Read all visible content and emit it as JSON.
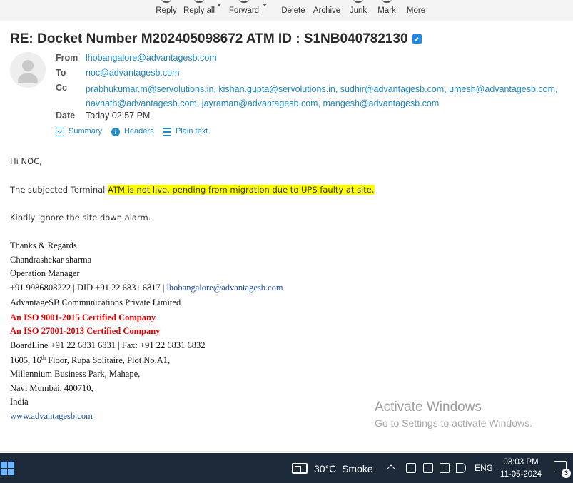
{
  "toolbar": {
    "reply": "Reply",
    "reply_all": "Reply all",
    "forward": "Forward",
    "delete": "Delete",
    "archive": "Archive",
    "junk": "Junk",
    "mark": "Mark",
    "more": "More"
  },
  "email": {
    "subject": "RE: Docket Number M202405098672 ATM ID : S1NB040782130",
    "from_label": "From",
    "from": "lhobangalore@advantagesb.com",
    "to_label": "To",
    "to": "noc@advantagesb.com",
    "cc_label": "Cc",
    "cc_line1": "prabhukumar.m@servolutions.in, kishan.gupta@servolutions.in, sudhir@advantagesb.com, umesh@advantagesb.com,",
    "cc_line2": "navnath@advantagesb.com, jayraman@advantagesb.com, mangesh@advantagesb.com",
    "date_label": "Date",
    "date": "Today 02:57 PM",
    "view_summary": "Summary",
    "view_headers": "Headers",
    "view_plain": "Plain text"
  },
  "body": {
    "greeting": "Hi NOC,",
    "line1_prefix": "The subjected Terminal ",
    "line1_highlight": "ATM is not live, pending from migration due to UPS faulty at site.",
    "line2": "Kindly ignore the site down alarm."
  },
  "signature": {
    "regards": "Thanks & Regards",
    "name": "Chandrashekar sharma",
    "title": "Operation Manager",
    "phone": "+91 9986808222 | DID +91 22 6831 6817 |  ",
    "phone_email": "lhobangalore@advantagesb.com",
    "company": "AdvantageSB Communications Private Limited",
    "iso1": "An ISO 9001-2015 Certified Company",
    "iso2": "An ISO 27001-2013 Certified Company",
    "boardline": "BoardLine +91 22 6831 6831 | Fax: +91 22 6831 6832",
    "addr1_pre": "1605, 16",
    "addr1_sup": "th",
    "addr1_post": " Floor, Rupa Solitaire, Plot No.A1,",
    "addr2": "Millennium Business Park, Mahape,",
    "addr3": "Navi Mumbai, 400710,",
    "addr4": "India",
    "website": "www.advantagesb.com"
  },
  "watermark": {
    "title": "Activate Windows",
    "subtitle": "Go to Settings to activate Windows."
  },
  "taskbar": {
    "temperature": "30°C",
    "weather": "Smoke",
    "language": "ENG",
    "time": "03:03 PM",
    "date": "11-05-2024",
    "notification_count": "3"
  }
}
